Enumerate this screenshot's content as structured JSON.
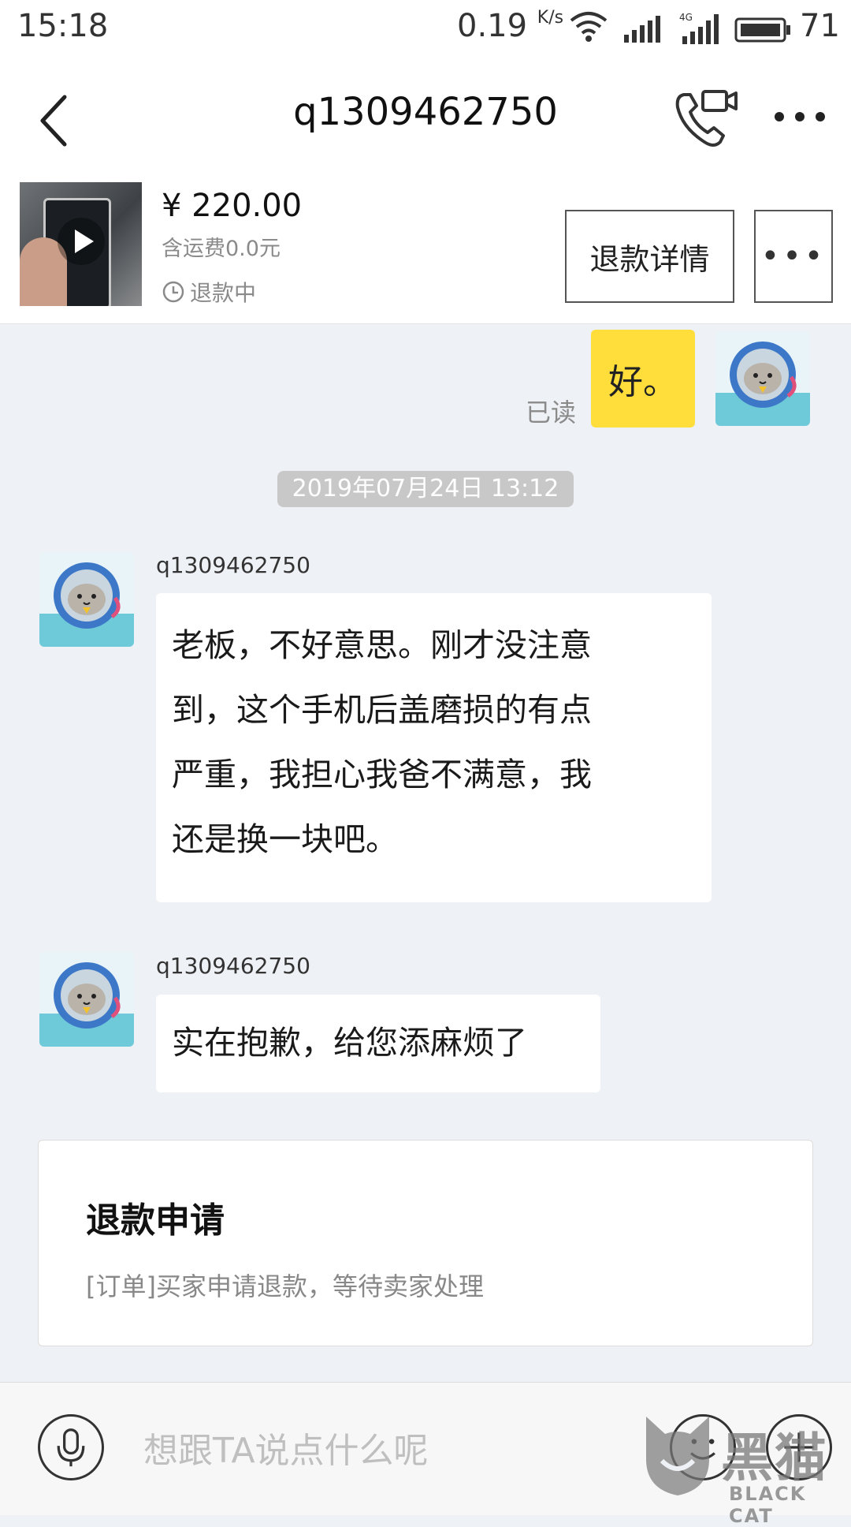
{
  "status_bar": {
    "time": "15:18",
    "net_speed": "0.19",
    "net_unit": "K/s",
    "network_type": "4G",
    "battery": "71"
  },
  "header": {
    "title": "q1309462750"
  },
  "product": {
    "price": "¥ 220.00",
    "shipping": "含运费0.0元",
    "status": "退款中",
    "refund_detail_label": "退款详情",
    "more_label": "•••"
  },
  "messages": [
    {
      "from": "me",
      "text": "好。",
      "status": "已读"
    },
    {
      "type": "timestamp",
      "text": "2019年07月24日 13:12"
    },
    {
      "from": "other",
      "sender": "q1309462750",
      "lines": [
        "老板，不好意思。刚才没注意",
        "到，这个手机后盖磨损的有点",
        "严重，我担心我爸不满意，我",
        "还是换一块吧。"
      ]
    },
    {
      "from": "other",
      "sender": "q1309462750",
      "text": "实在抱歉，给您添麻烦了"
    }
  ],
  "refund_card": {
    "title": "退款申请",
    "description": "[订单]买家申请退款，等待卖家处理"
  },
  "input": {
    "placeholder": "想跟TA说点什么呢"
  },
  "watermark": {
    "cn": "黑猫",
    "en": "BLACK CAT"
  },
  "colors": {
    "my_bubble": "#ffde3b",
    "chat_background": "#eef1f5",
    "timestamp_bg": "#c8c8c8"
  }
}
